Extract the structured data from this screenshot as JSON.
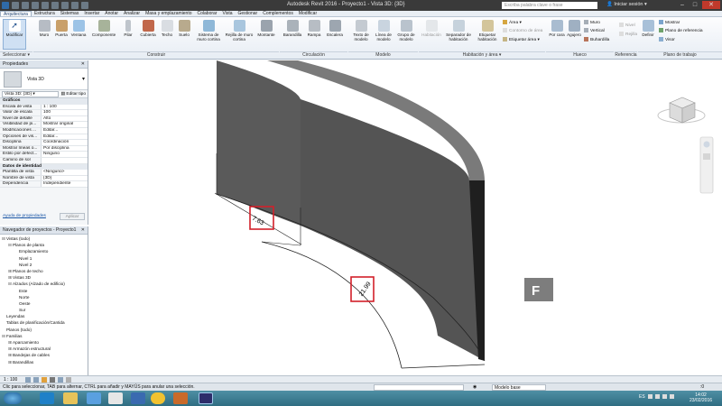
{
  "titlebar": {
    "title": "Autodesk Revit 2016 -    Proyecto1 - Vista 3D: {3D}",
    "search_placeholder": "Escriba palabra clave o frase",
    "login": "Iniciar sesión"
  },
  "tabs": [
    "Arquitectura",
    "Estructura",
    "Sistemas",
    "Insertar",
    "Anotar",
    "Analizar",
    "Masa y emplazamiento",
    "Colaborar",
    "Vista",
    "Gestionar",
    "Complementos",
    "Modificar"
  ],
  "ribbon": {
    "modify": "Modificar",
    "build": [
      "Muro",
      "Puerta",
      "Ventana",
      "Componente",
      "Pilar",
      "Cubierta",
      "Techo",
      "Suelo",
      "Sistema de muro cortina",
      "Rejilla de muro cortina",
      "Montante"
    ],
    "circulation": [
      "Barandilla",
      "Rampa",
      "Escalera"
    ],
    "model": [
      "Texto de modelo",
      "Línea de modelo",
      "Grupo de modelo"
    ],
    "room": [
      "Habitación",
      "Separador de habitación",
      "Etiquetar habitación"
    ],
    "area": [
      "Área",
      "Contorno de área",
      "Etiquetar área"
    ],
    "opening": [
      "Por cara",
      "Agujero",
      "Muro",
      "Vertical",
      "Buhardilla"
    ],
    "datum": [
      "Nivel",
      "Rejilla"
    ],
    "workplane": [
      "Definir",
      "Mostrar",
      "Plano de referencia",
      "Visor"
    ],
    "groups": [
      "Seleccionar",
      "Construir",
      "Circulación",
      "Modelo",
      "Habitación y área",
      "Hueco",
      "Referencia",
      "Plano de trabajo"
    ]
  },
  "properties": {
    "title": "Propiedades",
    "type": "Vista 3D",
    "selector": "Vista 3D: {3D}",
    "edit_type": "Editar tipo",
    "section_graphics": "Gráficos",
    "rows": [
      {
        "k": "Escala de vista",
        "v": "1 : 100"
      },
      {
        "k": "Valor de escala",
        "v": "100"
      },
      {
        "k": "Nivel de detalle",
        "v": "Alto"
      },
      {
        "k": "Visibilidad de pi...",
        "v": "Mostrar original"
      },
      {
        "k": "Modificaciones ...",
        "v": "Editar..."
      },
      {
        "k": "Opciones de vis...",
        "v": "Editar..."
      },
      {
        "k": "Disciplina",
        "v": "Coordinación"
      },
      {
        "k": "Mostrar líneas o...",
        "v": "Por disciplina"
      },
      {
        "k": "Estilo por defect...",
        "v": "Ninguno"
      },
      {
        "k": "Camino de sol",
        "v": ""
      }
    ],
    "section_identity": "Datos de identidad",
    "rows2": [
      {
        "k": "Plantilla de vista",
        "v": "<Ninguno>"
      },
      {
        "k": "Nombre de vista",
        "v": "{3D}"
      },
      {
        "k": "Dependencia",
        "v": "Independiente"
      }
    ],
    "help": "Ayuda de propiedades",
    "apply": "Aplicar"
  },
  "browser": {
    "title": "Navegador de proyectos - Proyecto1",
    "nodes": [
      {
        "t": "Vistas (todo)",
        "d": 0,
        "pm": "⊟"
      },
      {
        "t": "Planos de planta",
        "d": 1,
        "pm": "⊟"
      },
      {
        "t": "Emplazamiento",
        "d": 2,
        "pm": ""
      },
      {
        "t": "Nivel 1",
        "d": 2,
        "pm": ""
      },
      {
        "t": "Nivel 2",
        "d": 2,
        "pm": ""
      },
      {
        "t": "Planos de techo",
        "d": 1,
        "pm": "⊞"
      },
      {
        "t": "Vistas 3D",
        "d": 1,
        "pm": "⊞"
      },
      {
        "t": "Alzados (Alzado de edificio)",
        "d": 1,
        "pm": "⊟"
      },
      {
        "t": "Este",
        "d": 2,
        "pm": ""
      },
      {
        "t": "Norte",
        "d": 2,
        "pm": ""
      },
      {
        "t": "Oeste",
        "d": 2,
        "pm": ""
      },
      {
        "t": "Sur",
        "d": 2,
        "pm": ""
      },
      {
        "t": "Leyendas",
        "d": 0,
        "pm": ""
      },
      {
        "t": "Tablas de planificación/Cantida",
        "d": 0,
        "pm": ""
      },
      {
        "t": "Planos (todo)",
        "d": 0,
        "pm": ""
      },
      {
        "t": "Familias",
        "d": 0,
        "pm": "⊟"
      },
      {
        "t": "Aparcamiento",
        "d": 1,
        "pm": "⊞"
      },
      {
        "t": "Armazón estructural",
        "d": 1,
        "pm": "⊞"
      },
      {
        "t": "Bandejas de cables",
        "d": 1,
        "pm": "⊞"
      },
      {
        "t": "Barandillas",
        "d": 1,
        "pm": "⊞"
      }
    ]
  },
  "canvas": {
    "dim1": "7.63",
    "dim2": "21.99"
  },
  "viewbar": {
    "scale": "1 : 100"
  },
  "status": {
    "text": "Clic para seleccionar, TAB para alternar, CTRL para añadir y MAYÚS para anular una selección.",
    "model": "Modelo base",
    "selcount": ":0"
  },
  "taskbar": {
    "lang": "ES",
    "time": "14:02",
    "date": "23/02/2016"
  }
}
